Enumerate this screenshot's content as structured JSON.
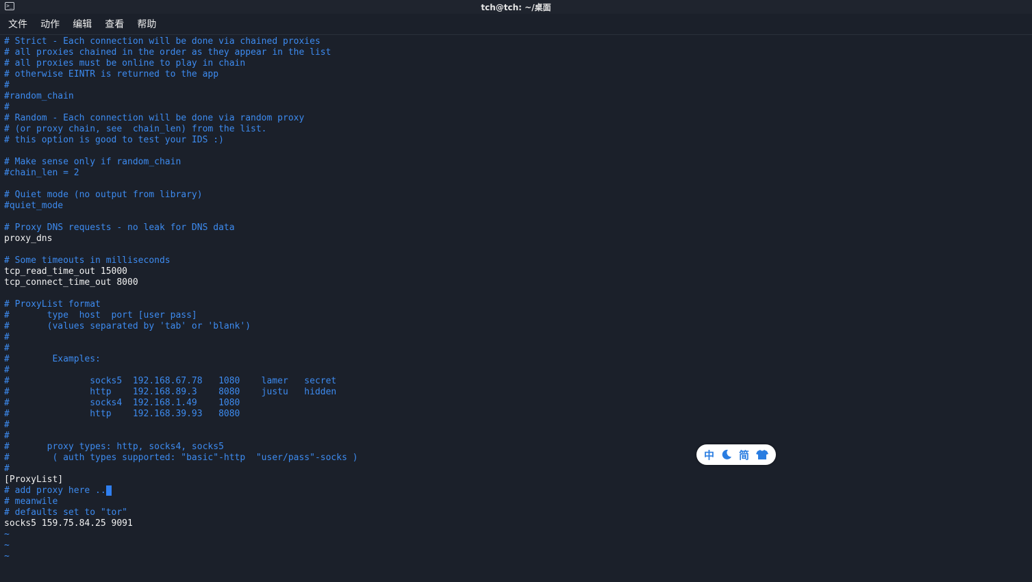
{
  "window": {
    "title": "tch@tch: ~/桌面"
  },
  "menu": [
    "文件",
    "动作",
    "编辑",
    "查看",
    "帮助"
  ],
  "lines": [
    "# Strict - Each connection will be done via chained proxies",
    "# all proxies chained in the order as they appear in the list",
    "# all proxies must be online to play in chain",
    "# otherwise EINTR is returned to the app",
    "#",
    "#random_chain",
    "#",
    "# Random - Each connection will be done via random proxy",
    "# (or proxy chain, see  chain_len) from the list.",
    "# this option is good to test your IDS :)",
    "",
    "# Make sense only if random_chain",
    "#chain_len = 2",
    "",
    "# Quiet mode (no output from library)",
    "#quiet_mode",
    "",
    "# Proxy DNS requests - no leak for DNS data",
    "proxy_dns",
    "",
    "# Some timeouts in milliseconds",
    "tcp_read_time_out 15000",
    "tcp_connect_time_out 8000",
    "",
    "# ProxyList format",
    "#       type  host  port [user pass]",
    "#       (values separated by 'tab' or 'blank')",
    "#",
    "#",
    "#        Examples:",
    "#",
    "#               socks5  192.168.67.78   1080    lamer   secret",
    "#               http    192.168.89.3    8080    justu   hidden",
    "#               socks4  192.168.1.49    1080",
    "#               http    192.168.39.93   8080",
    "#",
    "#",
    "#       proxy types: http, socks4, socks5",
    "#        ( auth types supported: \"basic\"-http  \"user/pass\"-socks )",
    "#",
    "[ProxyList]",
    "# add proxy here ...",
    "# meanwile",
    "# defaults set to \"tor\"",
    "socks5 159.75.84.25 9091",
    "~",
    "~",
    "~"
  ],
  "ime": {
    "chinese_label": "中",
    "moon_icon": "moon-icon",
    "simplified_label": "简",
    "shirt_icon": "shirt-icon",
    "accent": "#2a7de1"
  },
  "colors": {
    "background": "#1b202a",
    "comment": "#3d8bf0",
    "text": "#f2f2f2"
  }
}
